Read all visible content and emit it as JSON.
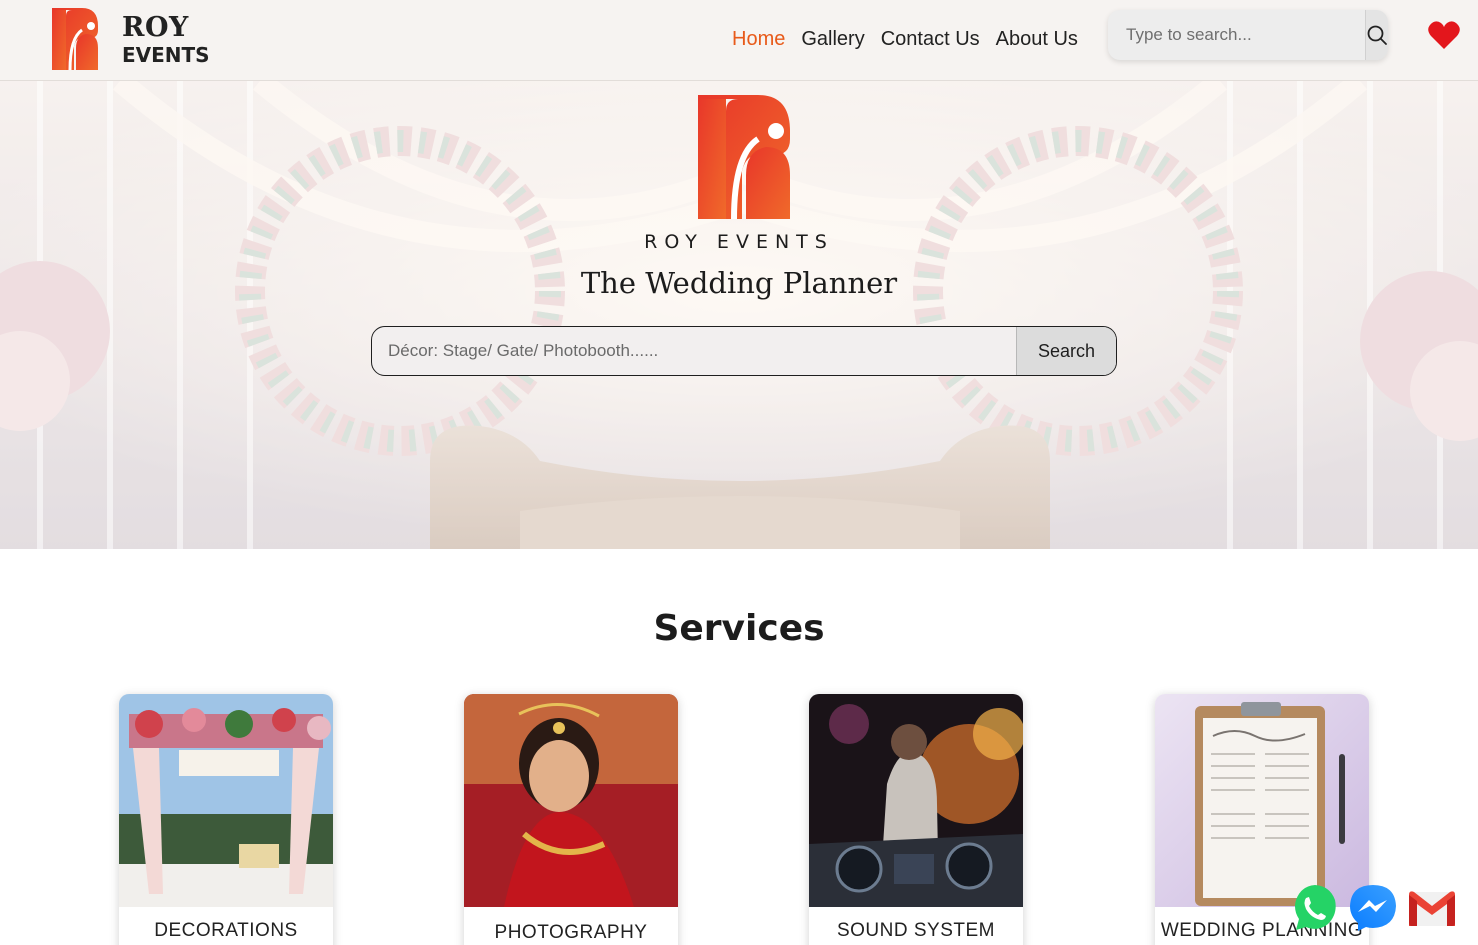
{
  "header": {
    "brand_line1": "ROY",
    "brand_line2": "EVENTS",
    "nav": [
      {
        "label": "Home",
        "active": true
      },
      {
        "label": "Gallery",
        "active": false
      },
      {
        "label": "Contact Us",
        "active": false
      },
      {
        "label": "About Us",
        "active": false
      }
    ],
    "search_placeholder": "Type to search...",
    "icons": {
      "search": "search-icon",
      "favorites": "heart-icon"
    }
  },
  "hero": {
    "brand": "ROY EVENTS",
    "tagline": "The Wedding Planner",
    "search_placeholder": "Décor: Stage/ Gate/ Photobooth......",
    "search_button": "Search"
  },
  "services": {
    "title": "Services",
    "items": [
      {
        "label": "DECORATIONS",
        "image": "decorated-mandap-photo"
      },
      {
        "label": "PHOTOGRAPHY",
        "image": "bride-portrait-photo"
      },
      {
        "label": "SOUND SYSTEM",
        "image": "dj-console-photo"
      },
      {
        "label": "WEDDING PLANNING",
        "image": "wedding-checklist-photo"
      }
    ]
  },
  "floating_contacts": [
    {
      "name": "whatsapp-icon",
      "color": "#25d366"
    },
    {
      "name": "messenger-icon",
      "color": "#1877f2"
    },
    {
      "name": "gmail-icon",
      "color": "#ea4335"
    }
  ],
  "colors": {
    "accent": "#e85a1a",
    "logo_red": "#e8412a",
    "heart": "#e3161c"
  }
}
